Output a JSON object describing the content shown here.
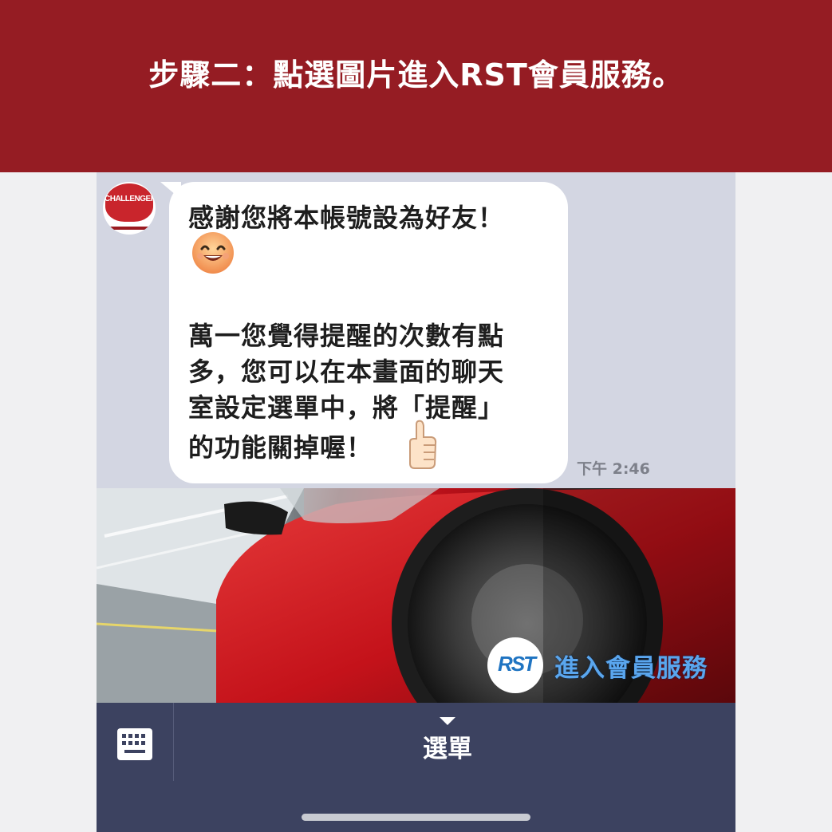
{
  "header": {
    "title": "步驟二：點選圖片進入RST會員服務。"
  },
  "chat": {
    "avatar": {
      "text": "CHALLENGER"
    },
    "message": {
      "line1": "感謝您將本帳號設為好友！",
      "line2": "萬一您覺得提醒的次數有點",
      "line3": "多，您可以在本畫面的聊天",
      "line4": "室設定選單中，將「提醒」",
      "line5": "的功能關掉喔！",
      "emoji_face": "smiling-face-emoji",
      "emoji_thumb": "thumbs-up-emoji"
    },
    "timestamp": "下午 2:46"
  },
  "banner": {
    "logo": "RST",
    "cta": "進入會員服務"
  },
  "bottom_bar": {
    "menu_label": "選單",
    "keyboard_icon": "keyboard-icon",
    "arrow_icon": "triangle-down-icon"
  },
  "colors": {
    "header_bg": "#951c23",
    "chat_bg": "#d3d6e2",
    "bottom_bar_bg": "#3c4260",
    "cta_blue": "#5aa6ee"
  }
}
